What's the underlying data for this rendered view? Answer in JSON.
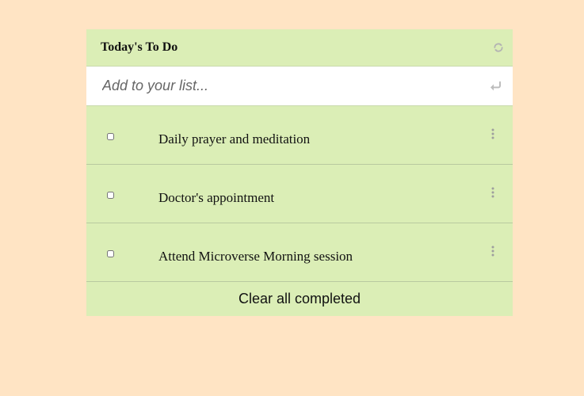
{
  "header": {
    "title": "Today's To Do",
    "refresh_icon": "refresh-icon"
  },
  "add_input": {
    "placeholder": "Add to your list...",
    "value": "",
    "enter_icon": "enter-icon"
  },
  "todos": [
    {
      "text": "Daily prayer and meditation",
      "completed": false
    },
    {
      "text": "Doctor's appointment",
      "completed": false
    },
    {
      "text": "Attend Microverse Morning session",
      "completed": false
    }
  ],
  "footer": {
    "clear_label": "Clear all completed"
  },
  "colors": {
    "page_background": "#ffe4c4",
    "card_background": "#dbeeb6",
    "input_background": "#ffffff",
    "icon_gray": "#b3b3b3"
  }
}
